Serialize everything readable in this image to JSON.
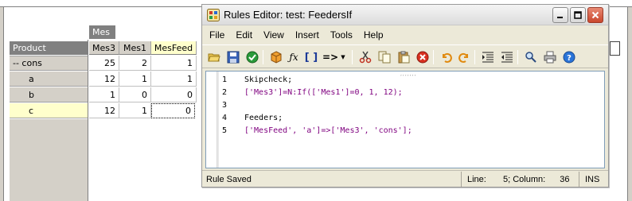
{
  "cube_view": {
    "column_dimension": "Mes",
    "row_dimension": "Product",
    "columns": [
      {
        "label": "Mes3",
        "selected": false
      },
      {
        "label": "Mes1",
        "selected": false
      },
      {
        "label": "MesFeed",
        "selected": true
      }
    ],
    "rows": [
      {
        "label": "-- cons",
        "selected": false,
        "values": [
          "25",
          "2",
          "1"
        ]
      },
      {
        "label": "a",
        "selected": false,
        "values": [
          "12",
          "1",
          "1"
        ]
      },
      {
        "label": "b",
        "selected": false,
        "values": [
          "1",
          "0",
          "0"
        ]
      },
      {
        "label": "c",
        "selected": true,
        "values": [
          "12",
          "1",
          "0"
        ]
      }
    ]
  },
  "window": {
    "title": "Rules Editor: test: FeedersIf",
    "menu": [
      "File",
      "Edit",
      "View",
      "Insert",
      "Tools",
      "Help"
    ],
    "toolbar_icons": [
      "open-folder-icon",
      "save-icon",
      "check-syntax-icon",
      "cube-icon",
      "function-icon",
      "brackets-icon",
      "feeder-arrow-icon",
      "dropdown-arrow-icon",
      "cut-icon",
      "copy-icon",
      "paste-icon",
      "delete-icon",
      "undo-icon",
      "redo-icon",
      "indent-icon",
      "outdent-icon",
      "find-icon",
      "print-icon",
      "help-icon"
    ],
    "code_lines": [
      {
        "num": "1",
        "text": "Skipcheck;"
      },
      {
        "num": "2",
        "text": "['Mes3']=N:If(['Mes1']=0, 1, 12);"
      },
      {
        "num": "3",
        "text": ""
      },
      {
        "num": "4",
        "text": "Feeders;"
      },
      {
        "num": "5",
        "text": "['MesFeed', 'a']=>['Mes3', 'cons'];"
      }
    ],
    "status": {
      "message": "Rule Saved",
      "line_label": "Line:",
      "position": "5; Column:",
      "column_value": "36",
      "mode": "INS"
    }
  },
  "colors": {
    "selection_yellow": "#ffffcc",
    "header_grey": "#808080",
    "keyword_blue": "#00007f",
    "string_purple": "#7f007f"
  }
}
